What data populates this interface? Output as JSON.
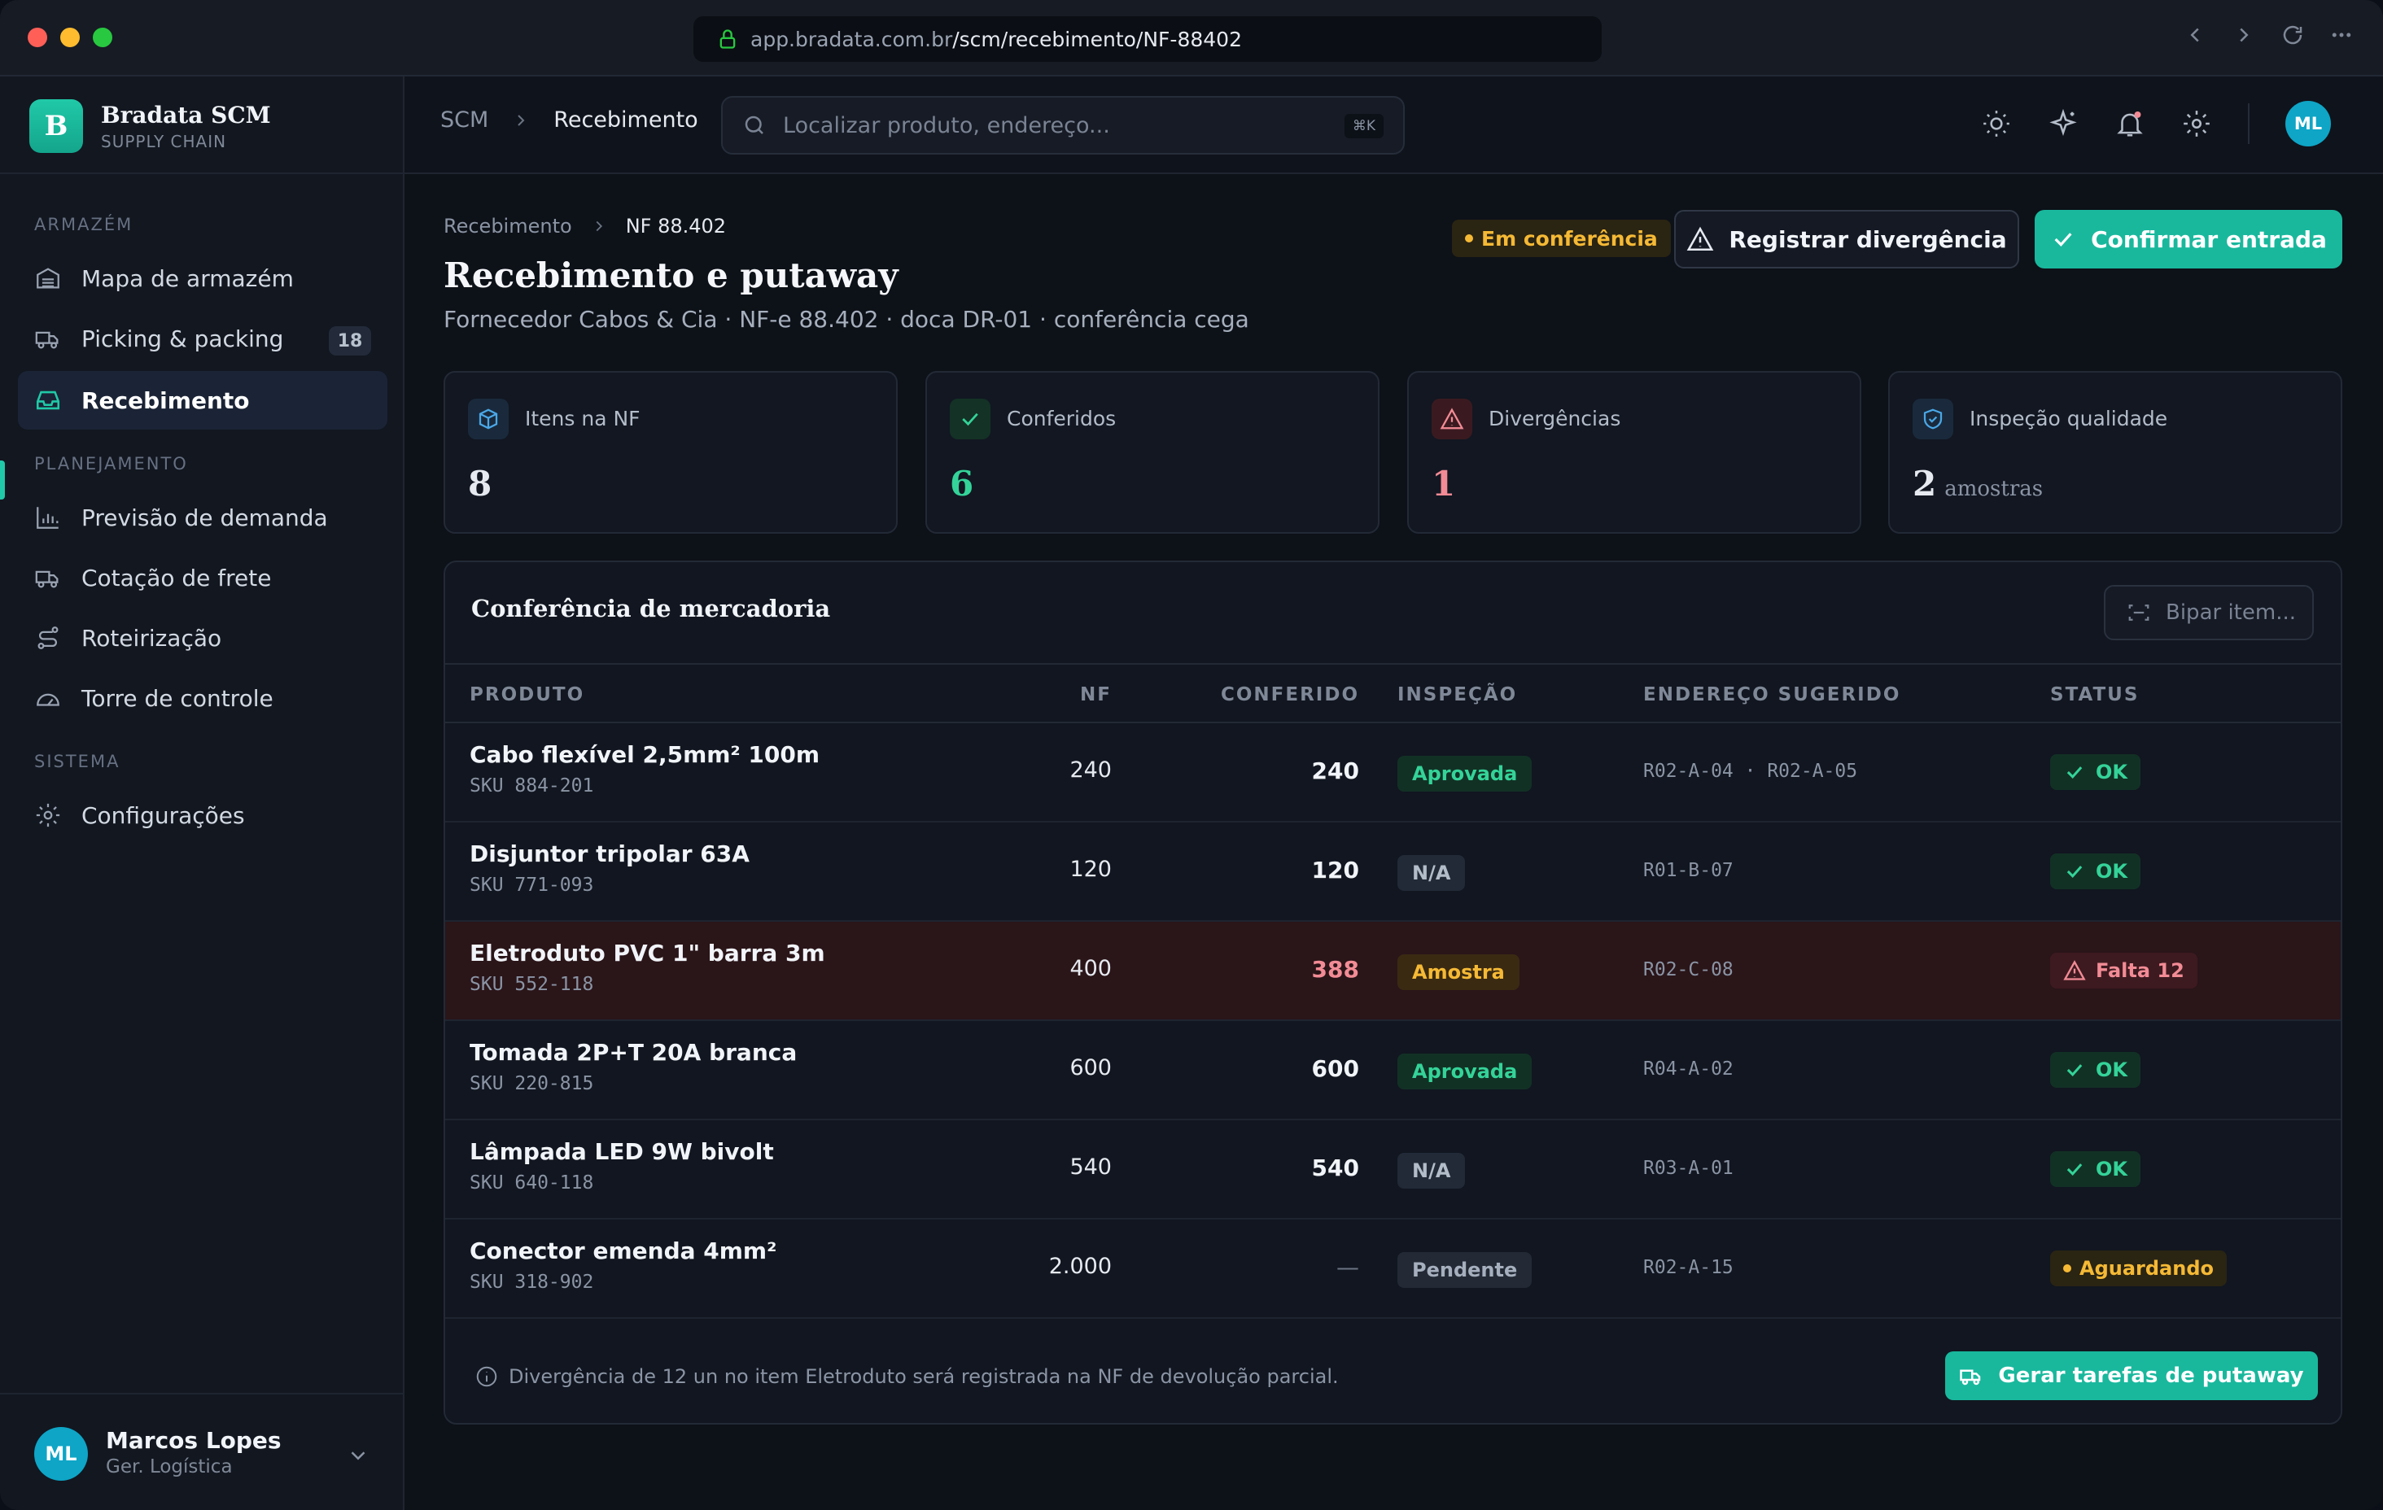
{
  "browser": {
    "url_prefix": "app.bradata.com.br",
    "url_path": "/scm/recebimento/NF-88402"
  },
  "brand": {
    "name": "Bradata SCM",
    "subtitle": "SUPPLY CHAIN",
    "logo_letter": "B"
  },
  "sidebar": {
    "sections": [
      {
        "title": "ARMAZÉM"
      },
      {
        "title": "PLANEJAMENTO"
      },
      {
        "title": "SISTEMA"
      }
    ],
    "items": [
      {
        "label": "Mapa de armazém",
        "icon": "warehouse-icon"
      },
      {
        "label": "Picking & packing",
        "icon": "truck-icon",
        "badge": "18"
      },
      {
        "label": "Recebimento",
        "icon": "inbox-icon",
        "active": true
      },
      {
        "label": "Previsão de demanda",
        "icon": "bar-chart-icon"
      },
      {
        "label": "Cotação de frete",
        "icon": "freight-icon"
      },
      {
        "label": "Roteirização",
        "icon": "route-icon"
      },
      {
        "label": "Torre de controle",
        "icon": "gauge-icon"
      },
      {
        "label": "Configurações",
        "icon": "gear-icon"
      }
    ]
  },
  "user": {
    "initials": "ML",
    "name": "Marcos Lopes",
    "role": "Ger. Logística"
  },
  "topbar": {
    "breadcrumb": [
      "SCM",
      "Recebimento"
    ],
    "search_placeholder": "Localizar produto, endereço...",
    "search_shortcut": "⌘K",
    "avatar_initials": "ML"
  },
  "page": {
    "breadcrumb": [
      "Recebimento",
      "NF 88.402"
    ],
    "title": "Recebimento e putaway",
    "subtitle": "Fornecedor Cabos & Cia · NF-e 88.402 · doca DR-01 · conferência cega",
    "status": "Em conferência",
    "btn_divergence": "Registrar divergência",
    "btn_confirm": "Confirmar entrada"
  },
  "stats": [
    {
      "label": "Itens na NF",
      "value": "8",
      "unit": "",
      "color": "#e6eaf0",
      "icon": "box-icon"
    },
    {
      "label": "Conferidos",
      "value": "6",
      "unit": "",
      "color": "#34d399",
      "icon": "check-icon"
    },
    {
      "label": "Divergências",
      "value": "1",
      "unit": "",
      "color": "#f28b95",
      "icon": "warning-icon"
    },
    {
      "label": "Inspeção qualidade",
      "value": "2",
      "unit": "amostras",
      "color": "#e6eaf0",
      "icon": "shield-icon"
    }
  ],
  "table": {
    "title": "Conferência de mercadoria",
    "scan_placeholder": "Bipar item...",
    "columns": [
      "PRODUTO",
      "NF",
      "CONFERIDO",
      "INSPEÇÃO",
      "ENDEREÇO SUGERIDO",
      "STATUS"
    ],
    "rows": [
      {
        "product": "Cabo flexível 2,5mm² 100m",
        "sku": "SKU 884-201",
        "nf": "240",
        "checked": "240",
        "inspection": "Aprovada",
        "address": "R02-A-04 · R02-A-05",
        "status": "OK"
      },
      {
        "product": "Disjuntor tripolar 63A",
        "sku": "SKU 771-093",
        "nf": "120",
        "checked": "120",
        "inspection": "N/A",
        "address": "R01-B-07",
        "status": "OK"
      },
      {
        "product": "Eletroduto PVC 1\" barra 3m",
        "sku": "SKU 552-118",
        "nf": "400",
        "checked": "388",
        "inspection": "Amostra",
        "address": "R02-C-08",
        "status": "Falta 12"
      },
      {
        "product": "Tomada 2P+T 20A branca",
        "sku": "SKU 220-815",
        "nf": "600",
        "checked": "600",
        "inspection": "Aprovada",
        "address": "R04-A-02",
        "status": "OK"
      },
      {
        "product": "Lâmpada LED 9W bivolt",
        "sku": "SKU 640-118",
        "nf": "540",
        "checked": "540",
        "inspection": "N/A",
        "address": "R03-A-01",
        "status": "OK"
      },
      {
        "product": "Conector emenda 4mm²",
        "sku": "SKU 318-902",
        "nf": "2.000",
        "checked": "—",
        "inspection": "Pendente",
        "address": "R02-A-15",
        "status": "Aguardando"
      }
    ],
    "footer_note": "Divergência de 12 un no item Eletroduto será registrada na NF de devolução parcial.",
    "btn_tasks": "Gerar tarefas de putaway"
  },
  "colors": {
    "accent": "#19b89d",
    "warning": "#f5b935",
    "danger": "#f28b95",
    "success": "#34d399"
  }
}
